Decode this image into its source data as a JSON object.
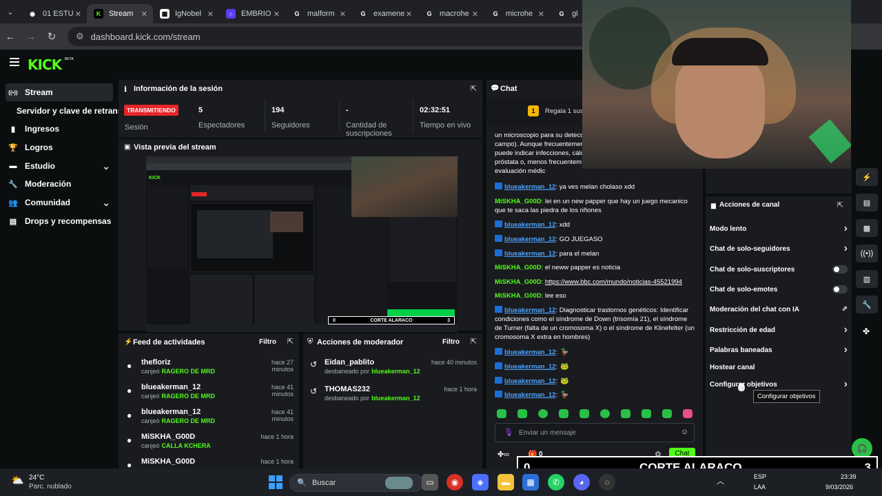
{
  "browser": {
    "tabs": [
      {
        "title": "01 ESTU",
        "favicon": "github-icon",
        "color": "#ffffff"
      },
      {
        "title": "Stream",
        "favicon": "kick-icon",
        "color": "#53fc18"
      },
      {
        "title": "IgNobel",
        "favicon": "page-icon",
        "color": "#ffffff"
      },
      {
        "title": "EMBRIO",
        "favicon": "purple-icon",
        "color": "#7b5cff"
      },
      {
        "title": "malform",
        "favicon": "google-icon",
        "color": "#ffffff"
      },
      {
        "title": "examene",
        "favicon": "google-icon",
        "color": "#ffffff"
      },
      {
        "title": "macrohe",
        "favicon": "google-icon",
        "color": "#ffffff"
      },
      {
        "title": "microhe",
        "favicon": "google-icon",
        "color": "#ffffff"
      },
      {
        "title": "gl",
        "favicon": "google-icon",
        "color": "#ffffff"
      }
    ],
    "url": "dashboard.kick.com/stream"
  },
  "kick": {
    "logo": "KICK",
    "beta": "BETA",
    "accent": "#53fc18"
  },
  "sidebar": {
    "items": [
      {
        "label": "Stream",
        "icon": "broadcast-icon",
        "active": true
      },
      {
        "label": "Servidor y clave de retransmisión",
        "icon": "",
        "sub": true
      },
      {
        "label": "Ingresos",
        "icon": "chart-icon"
      },
      {
        "label": "Logros",
        "icon": "trophy-icon"
      },
      {
        "label": "Estudio",
        "icon": "studio-icon",
        "chevron": true
      },
      {
        "label": "Moderación",
        "icon": "wrench-icon"
      },
      {
        "label": "Comunidad",
        "icon": "community-icon",
        "chevron": true
      },
      {
        "label": "Drops y recompensas",
        "icon": "gift-icon"
      }
    ]
  },
  "session": {
    "title": "Información de la sesión",
    "status": "TRANSMITIENDO",
    "status_label": "Sesión",
    "stats": [
      {
        "value": "5",
        "label": "Espectadores"
      },
      {
        "value": "194",
        "label": "Seguidores"
      },
      {
        "value": "-",
        "label": "Cantidad de suscripciones"
      },
      {
        "value": "02:32:51",
        "label": "Tiempo en vivo"
      }
    ]
  },
  "preview": {
    "title": "Vista previa del stream",
    "overlay_left": "0",
    "overlay_title": "CORTE ALARACO",
    "overlay_right": "3"
  },
  "feed": {
    "title": "Feed de actividades",
    "filter": "Filtro",
    "items": [
      {
        "name": "thefloriz",
        "action": "canjeó",
        "reward": "RAGERO DE MRD",
        "time": "hace 27 minutos"
      },
      {
        "name": "blueakerman_12",
        "action": "canjeó",
        "reward": "RAGERO DE MRD",
        "time": "hace 41 minutos"
      },
      {
        "name": "blueakerman_12",
        "action": "canjeó",
        "reward": "RAGERO DE MRD",
        "time": "hace 41 minutos"
      },
      {
        "name": "MiSKHA_G00D",
        "action": "canjeó",
        "reward": "CALLA KCHERA",
        "time": "hace 1 hora"
      },
      {
        "name": "MiSKHA_G00D",
        "action": "",
        "reward": "",
        "time": "hace 1 hora"
      }
    ]
  },
  "modactions": {
    "title": "Acciones de moderador",
    "filter": "Filtro",
    "items": [
      {
        "name": "Eidan_pablito",
        "action": "desbaneado por",
        "by": "blueakerman_12",
        "time": "hace 40 minutos"
      },
      {
        "name": "THOMAS232",
        "action": "desbaneado por",
        "by": "blueakerman_12",
        "time": "hace 1 hora"
      }
    ]
  },
  "chat": {
    "title": "Chat",
    "gift_banner": "Regala 1 susc",
    "gift_count": "1",
    "partial_top": "un microscopio para su detecc campo). Aunque frecuentemen puede indicar infecciones, cálc próstata o, menos frecuentem evaluación médic",
    "partial_lines": [
      "un microscopio para su detecc",
      "campo). Aunque frecuentemen",
      "puede indicar infecciones, cálc",
      "próstata o, menos frecuentem",
      "evaluación médic"
    ],
    "messages": [
      {
        "user": "blueakerman_12",
        "type": "blue",
        "text": ": ya ves melan cholaso xdd"
      },
      {
        "user": "MiSKHA_G00D",
        "type": "green",
        "text": ": lei en un new papper que hay un juego mecanico que te saca las piedra de los riñones"
      },
      {
        "user": "blueakerman_12",
        "type": "blue",
        "text": ": xdd"
      },
      {
        "user": "blueakerman_12",
        "type": "blue",
        "text": ": GO JUEGASO"
      },
      {
        "user": "blueakerman_12",
        "type": "blue",
        "text": ": para el melan"
      },
      {
        "user": "MiSKHA_G00D",
        "type": "green",
        "text": ": el neww papper es noticia"
      },
      {
        "user": "MiSKHA_G00D",
        "type": "green",
        "text": ": ",
        "link": "https://www.bbc.com/mundo/noticias-45521994"
      },
      {
        "user": "MiSKHA_G00D",
        "type": "green",
        "text": ": lee eso"
      },
      {
        "user": "blueakerman_12",
        "type": "blue",
        "text": ": Diagnosticar trastornos genéticos: Identificar condiciones como el síndrome de Down (trisomía 21), el síndrome de Turner (falta de un cromosoma X) o el síndrome de Klinefelter (un cromosoma X extra en hombres)"
      },
      {
        "user": "blueakerman_12",
        "type": "blue",
        "text": ":"
      },
      {
        "user": "blueakerman_12",
        "type": "blue",
        "text": ":"
      },
      {
        "user": "blueakerman_12",
        "type": "blue",
        "text": ":"
      },
      {
        "user": "blueakerman_12",
        "type": "blue",
        "text": ":"
      }
    ],
    "input_placeholder": "Enviar un mensaje",
    "counter": "0",
    "send_label": "Chat"
  },
  "channel_actions": {
    "title": "Acciones de canal",
    "items": [
      {
        "label": "Modo lento",
        "control": "arrow"
      },
      {
        "label": "Chat de solo-seguidores",
        "control": "arrow"
      },
      {
        "label": "Chat de solo-suscriptores",
        "control": "toggle"
      },
      {
        "label": "Chat de solo-emotes",
        "control": "toggle"
      },
      {
        "label": "Moderación del chat con IA",
        "control": "external"
      },
      {
        "label": "Restricción de edad",
        "control": "arrow"
      },
      {
        "label": "Palabras baneadas",
        "control": "arrow"
      },
      {
        "label": "Hostear canal",
        "control": "none"
      },
      {
        "label": "Configurar objetivos",
        "control": "arrow"
      }
    ],
    "tooltip": "Configurar objetivos"
  },
  "scoreboard": {
    "left": "0",
    "title": "CORTE ALARACO",
    "right": "3"
  },
  "taskbar": {
    "weather_temp": "24°C",
    "weather_desc": "Parc. nublado",
    "search": "Buscar",
    "lang_top": "ESP",
    "lang_bottom": "LAA",
    "time": "23:39",
    "date": "9/03/2026"
  }
}
